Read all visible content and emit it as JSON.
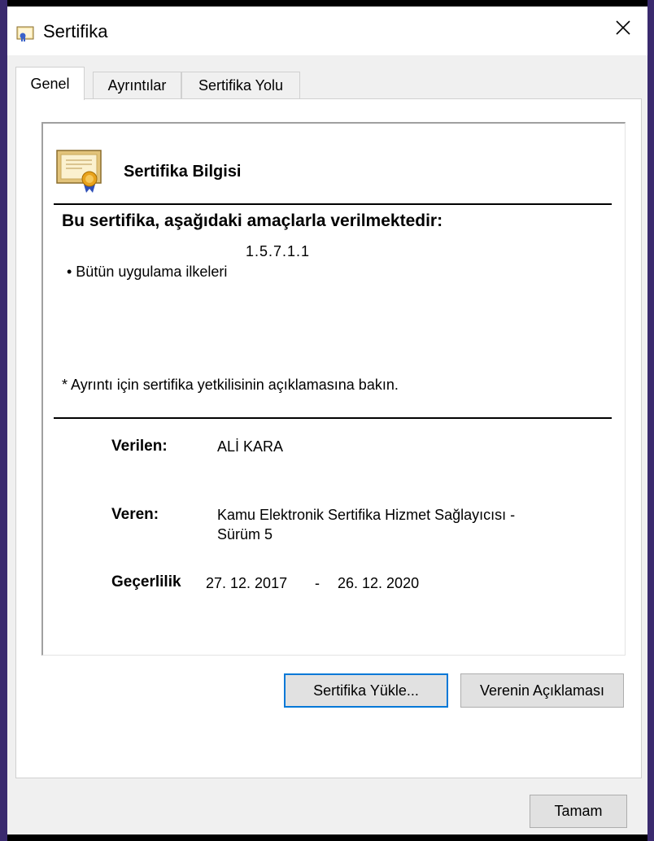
{
  "window": {
    "title": "Sertifika",
    "title_icon": "certificate-icon",
    "close_icon": "close-icon"
  },
  "tabs": [
    {
      "label": "Genel",
      "active": true
    },
    {
      "label": "Ayrıntılar",
      "active": false
    },
    {
      "label": "Sertifika Yolu",
      "active": false
    }
  ],
  "info": {
    "icon": "certificate-icon",
    "title": "Sertifika Bilgisi",
    "purpose_heading": "Bu sertifika, aşağıdaki amaçlarla verilmektedir:",
    "oid": "1.5.7.1.1",
    "policy": "• Bütün uygulama ilkeleri",
    "note": "* Ayrıntı için sertifika yetkilisinin açıklamasına bakın.",
    "issued_to_label": "Verilen:",
    "issued_to": "ALİ KARA",
    "issued_by_label": "Veren:",
    "issued_by_line1": "Kamu Elektronik Sertifika Hizmet Sağlayıcısı -",
    "issued_by_line2": "Sürüm 5",
    "validity_label": "Geçerlilik",
    "valid_from": "27. 12. 2017",
    "valid_sep": "-",
    "valid_to": "26. 12. 2020"
  },
  "buttons": {
    "install": "Sertifika Yükle...",
    "issuer_statement": "Verenin Açıklaması",
    "ok": "Tamam"
  },
  "colors": {
    "accent": "#0078d7",
    "dialog_bg": "#f0f0f0",
    "border": "#3a2a6e"
  }
}
